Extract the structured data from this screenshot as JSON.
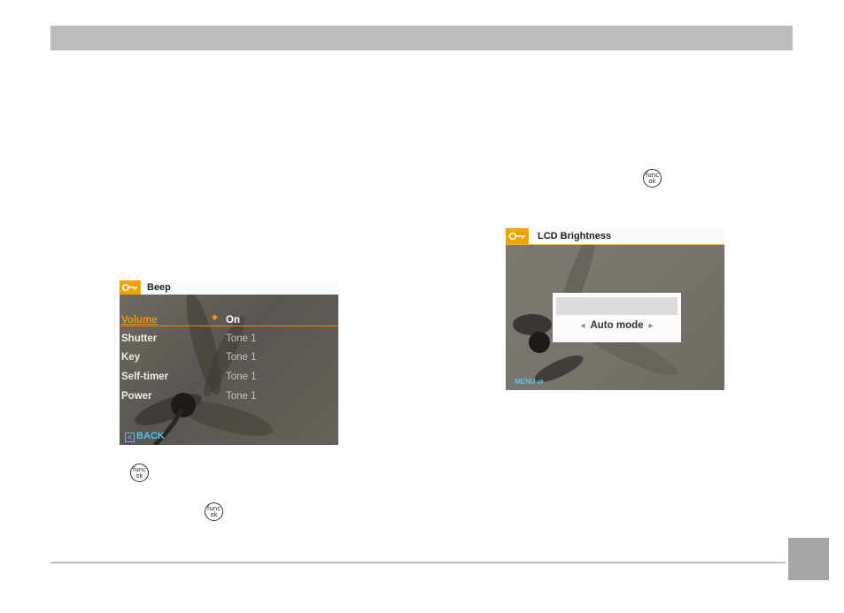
{
  "colors": {
    "accent_orange": "#f3a300",
    "back_blue": "#4ac7e6",
    "header_gray": "#bcbcbc"
  },
  "func_icon": {
    "line1": "func",
    "line2": "ok"
  },
  "beep_screen": {
    "title": "Beep",
    "icon": "key-icon",
    "rows": [
      {
        "label": "Volume",
        "value": "On"
      },
      {
        "label": "Shutter",
        "value": "Tone 1"
      },
      {
        "label": "Key",
        "value": "Tone 1"
      },
      {
        "label": "Self-timer",
        "value": "Tone 1"
      },
      {
        "label": "Power",
        "value": "Tone 1"
      }
    ],
    "back_label": "BACK"
  },
  "lcd_screen": {
    "title": "LCD Brightness",
    "icon": "key-icon",
    "mode": "Auto mode",
    "menu_hint": "MENU"
  }
}
